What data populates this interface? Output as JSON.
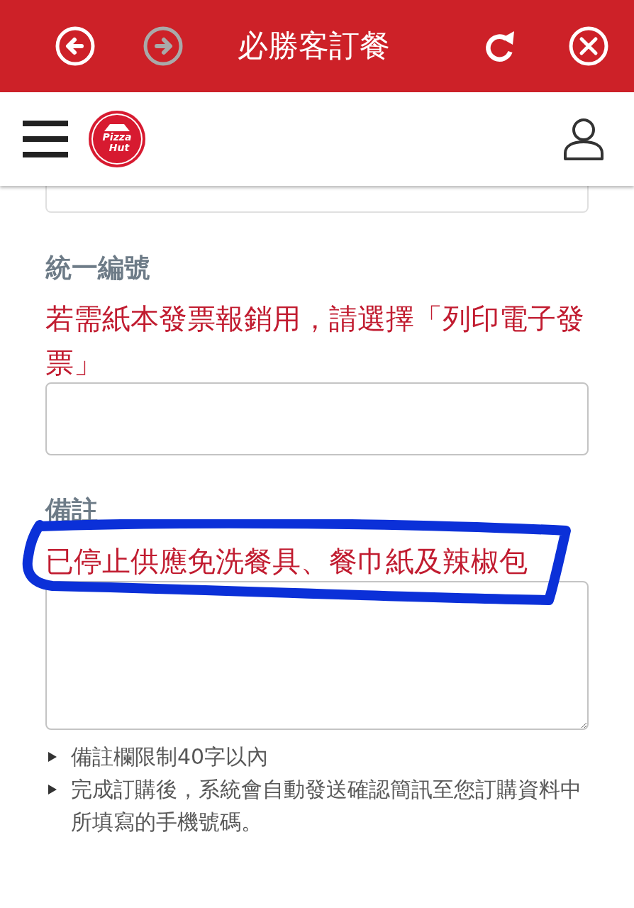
{
  "top_bar": {
    "left_buttons": [
      {
        "kind": "back",
        "disabled": false
      },
      {
        "kind": "forward",
        "disabled": true
      }
    ],
    "title": "必勝客訂餐",
    "right_buttons": [
      {
        "kind": "reload",
        "disabled": false
      },
      {
        "kind": "close",
        "disabled": false
      }
    ]
  },
  "site_header": {
    "logo_lines": [
      "Pizza",
      "Hut"
    ]
  },
  "form": {
    "clipped_field_above": true,
    "sections": [
      {
        "label": "統一編號",
        "hint": "若需紙本發票報銷用，請選擇「列印電子發票」",
        "circled": false,
        "kind": "input"
      },
      {
        "label": "備註",
        "hint": "已停止供應免洗餐具、餐巾紙及辣椒包",
        "circled": true,
        "kind": "textarea"
      }
    ]
  },
  "notes": [
    "備註欄限制40字以內",
    "完成訂購後，系統會自動發送確認簡訊至您訂購資料中所填寫的手機號碼。"
  ]
}
